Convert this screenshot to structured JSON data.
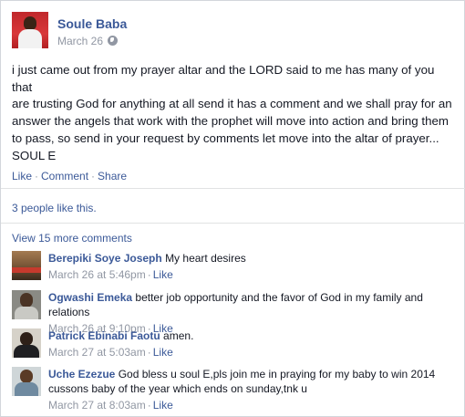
{
  "post": {
    "author": "Soule Baba",
    "date": "March 26",
    "privacy_icon": "globe-icon",
    "body_lines": [
      "i just came out from my prayer altar and the LORD said to me has many of you that",
      "are trusting God for anything at all send it has a comment and we shall pray for an",
      "answer the angels that work with the prophet will move into action and bring them",
      "to pass, so send in your request by comments let move into the altar of prayer...",
      "SOUL E"
    ]
  },
  "actions": {
    "like": "Like",
    "comment": "Comment",
    "share": "Share",
    "separator": "·"
  },
  "likes_text": "3 people like this.",
  "view_more": "View 15 more comments",
  "comments": [
    {
      "name": "Berepiki Soye Joseph",
      "text": "My heart desires",
      "time": "March 26 at 5:46pm",
      "like": "Like"
    },
    {
      "name": "Ogwashi Emeka",
      "text": "better job opportunity and the favor of God in my family and relations",
      "time": "March 26 at 9:10pm",
      "like": "Like"
    },
    {
      "name": "Patrick Ebinabi Faotu",
      "text": "amen.",
      "time": "March 27 at 5:03am",
      "like": "Like"
    },
    {
      "name": "Uche Ezezue",
      "text": "God bless u soul E,pls join me in praying for my baby to win 2014 cussons baby of the year which ends on sunday,tnk u",
      "time": "March 27 at 8:03am",
      "like": "Like"
    }
  ],
  "colors": {
    "link": "#3b5998",
    "meta": "#9197a3",
    "text": "#141823"
  }
}
